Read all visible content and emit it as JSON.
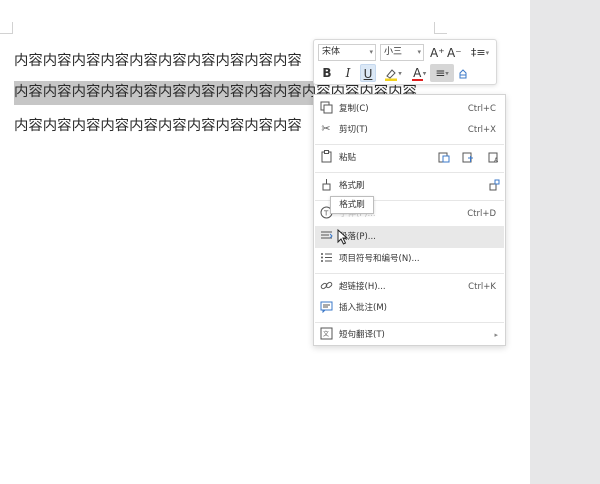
{
  "document": {
    "lines": [
      "内容内容内容内容内容内容内容内容内容内容",
      "内容内容内容内容内容内容内容内容内容内容内容内容内容内容",
      "内容内容内容内容内容内容内容内容内容内容"
    ]
  },
  "mini_toolbar": {
    "font": "宋体",
    "size": "小三",
    "grow_label": "A⁺",
    "shrink_label": "A⁻",
    "spacing_label": "‡≡",
    "bold_label": "B",
    "italic_label": "I",
    "underline_label": "U",
    "highlight_label": "ℳ",
    "font_color_label": "A",
    "align_label": "≡",
    "clear_label": "⌂",
    "highlight_color": "#f2d21b",
    "font_color": "#e02020"
  },
  "context_menu": {
    "items": [
      {
        "label": "复制(C)",
        "shortcut": "Ctrl+C",
        "icon": "copy-icon"
      },
      {
        "label": "剪切(T)",
        "shortcut": "Ctrl+X",
        "icon": "cut-icon"
      },
      {
        "label": "粘贴",
        "shortcut": "",
        "icon": "paste-icon"
      },
      {
        "label": "格式刷",
        "shortcut": "",
        "icon": "format-painter-icon"
      },
      {
        "label": "字体(F)...",
        "shortcut": "Ctrl+D",
        "icon": "font-icon"
      },
      {
        "label": "段落(P)...",
        "shortcut": "",
        "icon": "paragraph-icon"
      },
      {
        "label": "项目符号和编号(N)...",
        "shortcut": "",
        "icon": "bullets-icon"
      },
      {
        "label": "超链接(H)...",
        "shortcut": "Ctrl+K",
        "icon": "hyperlink-icon"
      },
      {
        "label": "插入批注(M)",
        "shortcut": "",
        "icon": "comment-icon"
      },
      {
        "label": "短句翻译(T)",
        "shortcut": "",
        "icon": "translate-icon"
      }
    ]
  },
  "tooltip": {
    "text": "格式刷"
  }
}
